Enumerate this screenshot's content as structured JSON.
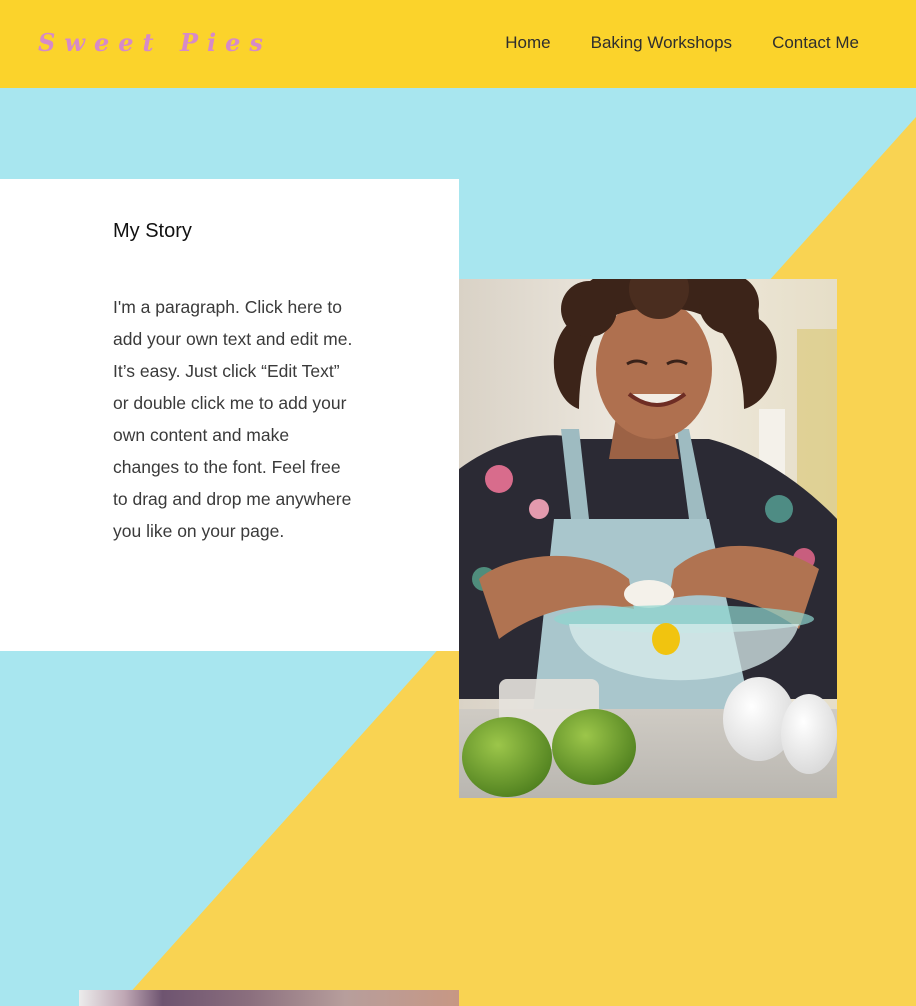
{
  "header": {
    "logo": "Sweet Pies",
    "nav": [
      {
        "label": "Home"
      },
      {
        "label": "Baking Workshops"
      },
      {
        "label": "Contact Me"
      }
    ]
  },
  "story": {
    "title": "My Story",
    "paragraph": "I'm a paragraph. Click here to add your own text and edit me. It’s easy. Just click “Edit Text” or double click me to add your own content and make changes to the font. Feel free to drag and drop me anywhere you like on your page."
  },
  "colors": {
    "header_bg": "#FBD32B",
    "logo": "#D68AC8",
    "sky": "#A8E6EF",
    "sun": "#F9D352",
    "card": "#FFFFFF"
  }
}
